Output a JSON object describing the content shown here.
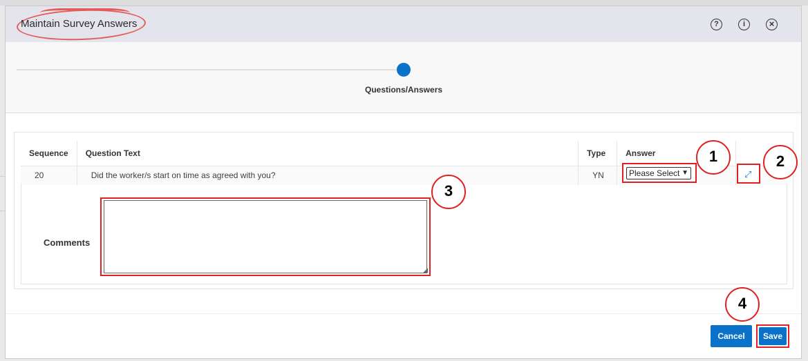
{
  "dialog": {
    "title": "Maintain Survey Answers",
    "header_icons": [
      {
        "name": "help-icon",
        "glyph": "?"
      },
      {
        "name": "info-icon",
        "glyph": "i"
      },
      {
        "name": "close-icon",
        "glyph": "×"
      }
    ]
  },
  "wizard": {
    "step_label": "Questions/Answers"
  },
  "table": {
    "headers": {
      "sequence": "Sequence",
      "question_text": "Question Text",
      "type": "Type",
      "answer": "Answer"
    },
    "rows": [
      {
        "sequence": "20",
        "question_text": "Did the worker/s start on time as agreed with you?",
        "type": "YN",
        "answer": "Please Select"
      }
    ]
  },
  "comments": {
    "label": "Comments",
    "value": ""
  },
  "buttons": {
    "cancel": "Cancel",
    "save": "Save"
  },
  "callouts": [
    "1",
    "2",
    "3",
    "4"
  ],
  "colors": {
    "accent_blue": "#0a72c9",
    "annotation_red": "#e02020"
  }
}
